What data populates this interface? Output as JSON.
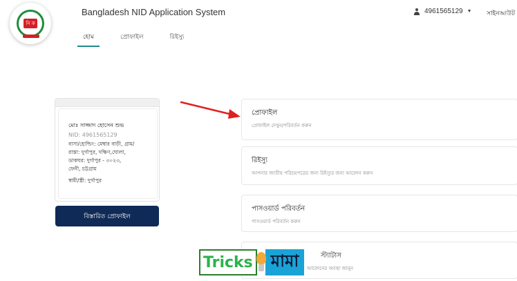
{
  "header": {
    "app_title": "Bangladesh NID Application System",
    "user_id": "4961565129",
    "logout_label": "সাইনআউট",
    "logo_text": "নি ক"
  },
  "tabs": [
    {
      "label": "হোম",
      "active": true
    },
    {
      "label": "প্রোফাইল",
      "active": false
    },
    {
      "label": "রিইস্যু",
      "active": false
    }
  ],
  "profile": {
    "photo_alt": "",
    "name": "মোঃ সাজ্জাদ হোসেন শুভ",
    "nid": "NID: 4961565129",
    "address_line1": "বাসা/হোল্ডিং: মেম্বার বাড়ী, গ্রাম/",
    "address_line2": "রাস্তা: দুর্গাপুর, দক্ষিণ,ঘোলা,",
    "address_line3": "ডাকঘর: দুর্গাপুর - ৩০২৩,",
    "address_line4": "ফেনী, চট্টগ্রাম",
    "spouse": "স্বামী/স্ত্রী: দুর্গাপুর",
    "detail_button": "বিস্তারিত প্রোফাইল"
  },
  "menu": [
    {
      "title": "প্রোফাইল",
      "subtitle": "প্রোফাইল দেখুন/পরিবর্তন করুন"
    },
    {
      "title": "রিইস্যু",
      "subtitle": "আপনার জাতীয় পরিচয়পত্রের জন্য রিইস্যুর জন্য আবেদন করুন"
    },
    {
      "title": "পাসওয়ার্ড পরিবর্তন",
      "subtitle": "পাসওয়ার্ড পরিবর্তন করুন"
    },
    {
      "title": "স্ট্যাটাস",
      "subtitle": "আবেদনের অবস্থা জানুন"
    }
  ],
  "watermark": {
    "left": "Tricks",
    "right": "মামা"
  },
  "colors": {
    "primary_button": "#0f2a56",
    "tab_active": "#1f8a8a",
    "arrow": "#e02020"
  }
}
